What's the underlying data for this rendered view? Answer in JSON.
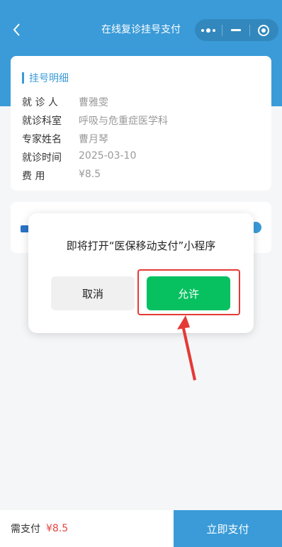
{
  "nav": {
    "title": "在线复诊挂号支付"
  },
  "card": {
    "title": "挂号明细",
    "rows": [
      {
        "label": "就 诊 人",
        "value": "曹雅雯"
      },
      {
        "label": "就诊科室",
        "value": "呼吸与危重症医学科"
      },
      {
        "label": "专家姓名",
        "value": "曹月琴"
      },
      {
        "label": "就诊时间",
        "value": "2025-03-10"
      },
      {
        "label": "费 用",
        "value": "¥8.5"
      }
    ]
  },
  "dialog": {
    "message": "即将打开“医保移动支付”小程序",
    "cancel_label": "取消",
    "allow_label": "允许"
  },
  "footer": {
    "amount_label": "需支付",
    "amount_value": "¥8.5",
    "pay_label": "立即支付"
  },
  "colors": {
    "primary": "#3a9bd8",
    "allow": "#07c160",
    "highlight": "#e53935",
    "price": "#e64340"
  }
}
